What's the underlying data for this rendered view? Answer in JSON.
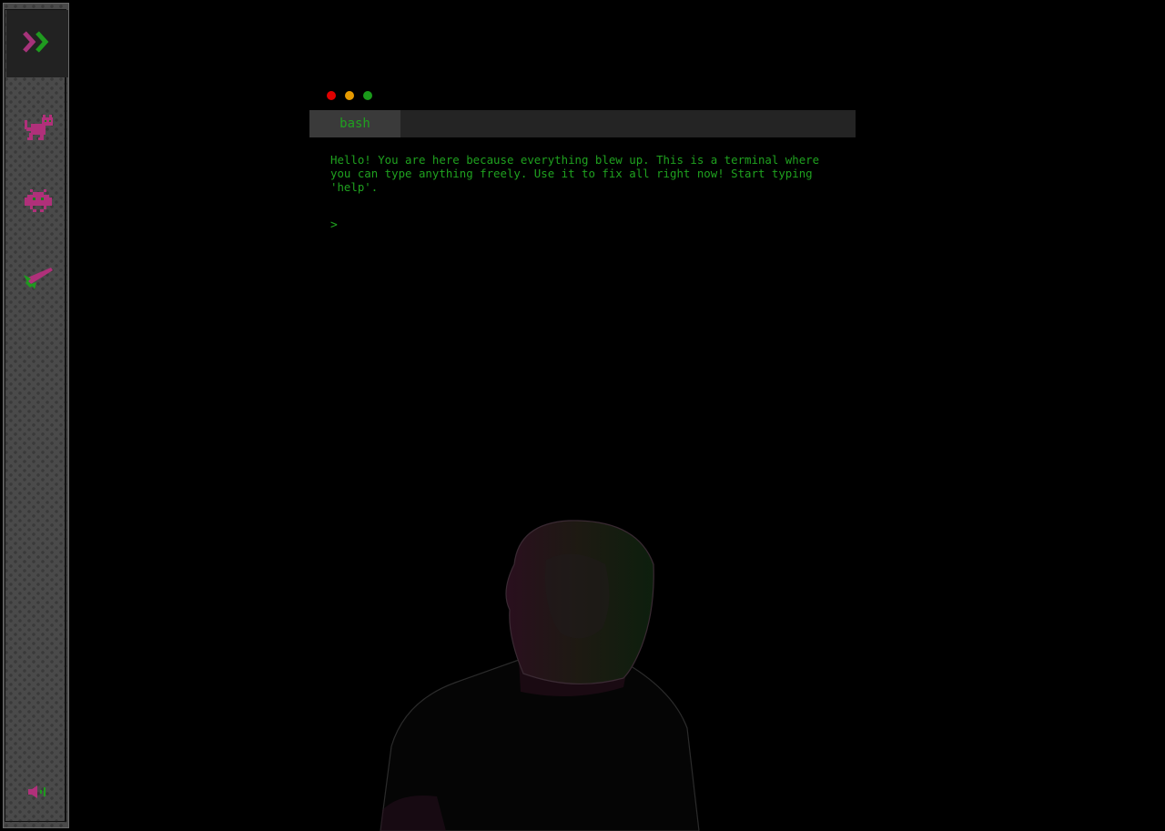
{
  "sidebar": {
    "items": [
      {
        "name": "expand",
        "icon": "double-chevron-right-icon"
      },
      {
        "name": "cat",
        "icon": "cat-icon"
      },
      {
        "name": "invader",
        "icon": "space-invader-icon"
      },
      {
        "name": "rocket",
        "icon": "rocket-icon"
      },
      {
        "name": "sound",
        "icon": "volume-icon"
      }
    ]
  },
  "terminal": {
    "tab_label": "bash",
    "message": "Hello! You are here because everything blew up. This is a terminal where you can type anything freely. Use it to fix all right now! Start typing 'help'.",
    "prompt": ">",
    "traffic_lights": [
      "#e00000",
      "#e69a00",
      "#1a9a1a"
    ]
  },
  "colors": {
    "accent_green": "#1fa11f",
    "accent_magenta": "#b0307a",
    "background": "#000000"
  }
}
